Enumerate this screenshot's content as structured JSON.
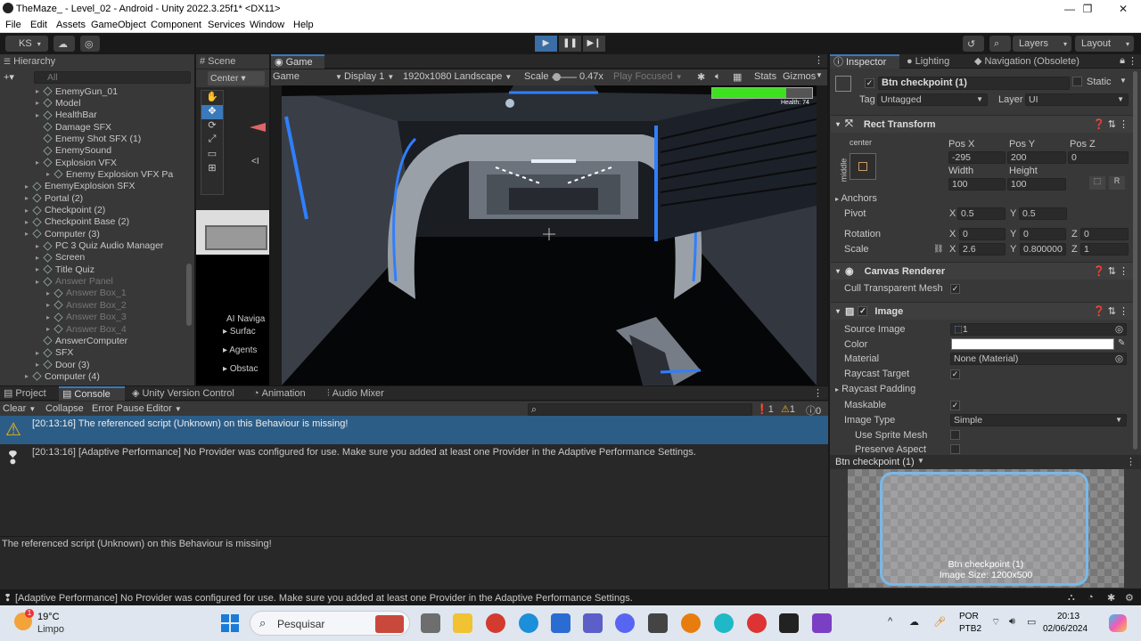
{
  "window": {
    "title": "TheMaze_ - Level_02 - Android - Unity 2022.3.25f1* <DX11>",
    "minimize": "—",
    "maximize": "❐",
    "close": "✕"
  },
  "menu": [
    "File",
    "Edit",
    "Assets",
    "GameObject",
    "Component",
    "Services",
    "Window",
    "Help"
  ],
  "toolbar": {
    "account": "KS",
    "layers": "Layers",
    "layout": "Layout"
  },
  "hierarchy": {
    "tab": "Hierarchy",
    "search_placeholder": "All",
    "items": [
      {
        "label": "EnemyGun_01",
        "indent": 2,
        "arrow": true,
        "dim": false
      },
      {
        "label": "Model",
        "indent": 2,
        "arrow": true,
        "dim": false
      },
      {
        "label": "HealthBar",
        "indent": 2,
        "arrow": true,
        "dim": false
      },
      {
        "label": "Damage SFX",
        "indent": 2,
        "arrow": false,
        "dim": false
      },
      {
        "label": "Enemy Shot SFX (1)",
        "indent": 2,
        "arrow": false,
        "dim": false
      },
      {
        "label": "EnemySound",
        "indent": 2,
        "arrow": false,
        "dim": false
      },
      {
        "label": "Explosion VFX",
        "indent": 2,
        "arrow": true,
        "dim": false
      },
      {
        "label": "Enemy Explosion VFX Pa",
        "indent": 3,
        "arrow": true,
        "dim": false
      },
      {
        "label": "EnemyExplosion SFX",
        "indent": 1,
        "arrow": true,
        "dim": false
      },
      {
        "label": "Portal (2)",
        "indent": 1,
        "arrow": true,
        "dim": false
      },
      {
        "label": "Checkpoint (2)",
        "indent": 1,
        "arrow": true,
        "dim": false
      },
      {
        "label": "Checkpoint Base (2)",
        "indent": 1,
        "arrow": true,
        "dim": false
      },
      {
        "label": "Computer (3)",
        "indent": 1,
        "arrow": true,
        "dim": false
      },
      {
        "label": "PC 3 Quiz Audio Manager",
        "indent": 2,
        "arrow": true,
        "dim": false
      },
      {
        "label": "Screen",
        "indent": 2,
        "arrow": true,
        "dim": false
      },
      {
        "label": "Title Quiz",
        "indent": 2,
        "arrow": true,
        "dim": false
      },
      {
        "label": "Answer Panel",
        "indent": 2,
        "arrow": true,
        "dim": true
      },
      {
        "label": "Answer Box_1",
        "indent": 3,
        "arrow": true,
        "dim": true
      },
      {
        "label": "Answer Box_2",
        "indent": 3,
        "arrow": true,
        "dim": true
      },
      {
        "label": "Answer Box_3",
        "indent": 3,
        "arrow": true,
        "dim": true
      },
      {
        "label": "Answer Box_4",
        "indent": 3,
        "arrow": true,
        "dim": true
      },
      {
        "label": "AnswerComputer",
        "indent": 2,
        "arrow": false,
        "dim": false
      },
      {
        "label": "SFX",
        "indent": 2,
        "arrow": true,
        "dim": false
      },
      {
        "label": "Door (3)",
        "indent": 2,
        "arrow": true,
        "dim": false
      },
      {
        "label": "Computer (4)",
        "indent": 1,
        "arrow": true,
        "dim": false
      }
    ]
  },
  "scene": {
    "tab": "Scene",
    "pivot": "Center",
    "ai_nav": "AI Naviga",
    "ai_items": [
      "Surfac",
      "Agents",
      "Obstac"
    ]
  },
  "game": {
    "tab": "Game",
    "view": "Game",
    "display": "Display 1",
    "resolution": "1920x1080 Landscape",
    "scale_label": "Scale",
    "scale_value": "0.47x",
    "play_focused": "Play Focused",
    "stats": "Stats",
    "gizmos": "Gizmos",
    "health_text": "Health: 74",
    "health_fraction": 0.74
  },
  "inspector": {
    "tabs": [
      "Inspector",
      "Lighting",
      "Navigation (Obsolete)"
    ],
    "object_name": "Btn checkpoint (1)",
    "static": "Static",
    "tag_label": "Tag",
    "tag": "Untagged",
    "layer_label": "Layer",
    "layer": "UI",
    "rect_transform": {
      "title": "Rect Transform",
      "anchor_h": "center",
      "anchor_v": "middle",
      "labels": [
        "Pos X",
        "Pos Y",
        "Pos Z"
      ],
      "values": [
        "-295",
        "200",
        "0"
      ],
      "size_labels": [
        "Width",
        "Height"
      ],
      "size_values": [
        "100",
        "100"
      ],
      "anchors": "Anchors",
      "pivot": "Pivot",
      "pivot_x": "0.5",
      "pivot_y": "0.5",
      "rotation": "Rotation",
      "rot": [
        "0",
        "0",
        "0"
      ],
      "scale": "Scale",
      "scl": [
        "2.6",
        "0.800000",
        "1"
      ],
      "x": "X",
      "y": "Y",
      "z": "Z",
      "r": "R"
    },
    "canvas_renderer": {
      "title": "Canvas Renderer",
      "cull_label": "Cull Transparent Mesh"
    },
    "image": {
      "title": "Image",
      "source_label": "Source Image",
      "source": "1",
      "color_label": "Color",
      "material_label": "Material",
      "material": "None (Material)",
      "raycast_label": "Raycast Target",
      "padding_label": "Raycast Padding",
      "maskable_label": "Maskable",
      "type_label": "Image Type",
      "type": "Simple",
      "sprite_mesh": "Use Sprite Mesh",
      "preserve": "Preserve Aspect"
    },
    "preview": {
      "header": "Btn checkpoint (1)",
      "name": "Btn checkpoint (1)",
      "size": "Image Size: 1200x500"
    }
  },
  "bottom": {
    "tabs": [
      "Project",
      "Console",
      "Unity Version Control",
      "Animation",
      "Audio Mixer"
    ],
    "buttons": [
      "Clear",
      "Collapse",
      "Error Pause",
      "Editor"
    ],
    "counts": [
      "1",
      "1",
      "0"
    ],
    "messages": [
      "[20:13:16] The referenced script (Unknown) on this Behaviour is missing!",
      "[20:13:16] [Adaptive Performance] No Provider was configured for use. Make sure you added at least one Provider in the Adaptive Performance Settings."
    ],
    "detail": "The referenced script (Unknown) on this Behaviour is missing!"
  },
  "status": {
    "text": "[Adaptive Performance] No Provider was configured for use. Make sure you added at least one Provider in the Adaptive Performance Settings."
  },
  "taskbar": {
    "temp": "19°C",
    "weather": "Limpo",
    "search": "Pesquisar",
    "lang1": "POR",
    "lang2": "PTB2",
    "time": "20:13",
    "date": "02/06/2024",
    "badge": "1"
  },
  "colors": {
    "accent": "#3a79bb",
    "health": "#3ce21e",
    "warning": "#e8b217",
    "console_selected": "#2c5d87"
  }
}
